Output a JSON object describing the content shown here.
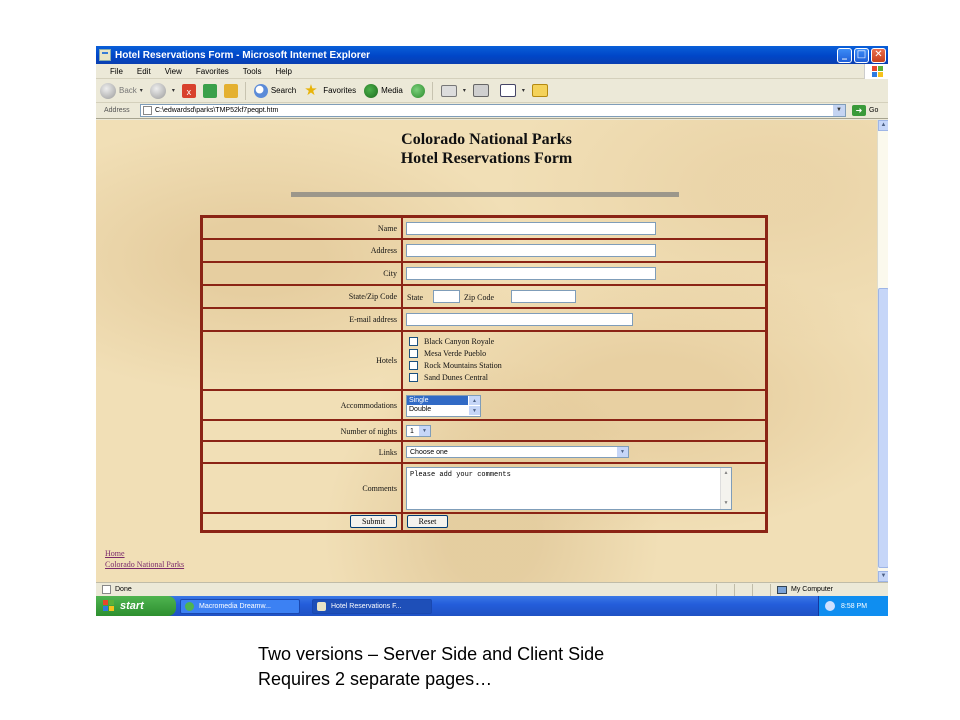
{
  "window": {
    "title": "Hotel Reservations Form - Microsoft Internet Explorer",
    "controls": {
      "minimize": "_",
      "maximize": "□",
      "close": "✕"
    }
  },
  "menu": [
    "File",
    "Edit",
    "View",
    "Favorites",
    "Tools",
    "Help"
  ],
  "toolbar": {
    "back_label": "Back",
    "search_label": "Search",
    "favorites_label": "Favorites",
    "media_label": "Media",
    "dropdown_arrow": "▾"
  },
  "address_bar": {
    "label": "Address",
    "value": "C:\\edwardsd\\parks\\TMP52kf7peqpt.htm",
    "go_label": "Go",
    "go_arrow": "➜",
    "dropdown_arrow": "▼"
  },
  "page": {
    "title_line1": "Colorado National Parks",
    "title_line2": "Hotel Reservations Form"
  },
  "form": {
    "name_label": "Name",
    "address_label": "Address",
    "city_label": "City",
    "state_zip_label": "State/Zip Code",
    "state_inline_label": "State",
    "zip_inline_label": "Zip Code",
    "email_label": "E-mail address",
    "hotels_label": "Hotels",
    "hotels": [
      "Black Canyon Royale",
      "Mesa Verde Pueblo",
      "Rock Mountains Station",
      "Sand Dunes Central"
    ],
    "accommodations_label": "Accommodations",
    "accommodations_options": [
      "Single",
      "Double"
    ],
    "accommodations_selected": "Single",
    "nights_label": "Number of nights",
    "nights_value": "1",
    "links_label": "Links",
    "links_value": "Choose one",
    "comments_label": "Comments",
    "comments_value": "Please add your comments",
    "submit_label": "Submit",
    "reset_label": "Reset",
    "scroll_up": "▲",
    "scroll_down": "▼"
  },
  "page_links": [
    "Home",
    "Colorado National Parks"
  ],
  "status": {
    "text": "Done",
    "zone": "My Computer"
  },
  "taskbar": {
    "start_label": "start",
    "tasks": [
      "Macromedia Dreamw...",
      "Hotel Reservations F..."
    ],
    "clock": "8:58 PM"
  },
  "caption": {
    "line1": "Two versions – Server Side and Client Side",
    "line2": "Requires 2 separate pages…"
  },
  "colors": {
    "form_border": "#8b2415",
    "page_background": "#f1dfb6",
    "titlebar": "#0046c8",
    "link": "#7b2a6b"
  }
}
